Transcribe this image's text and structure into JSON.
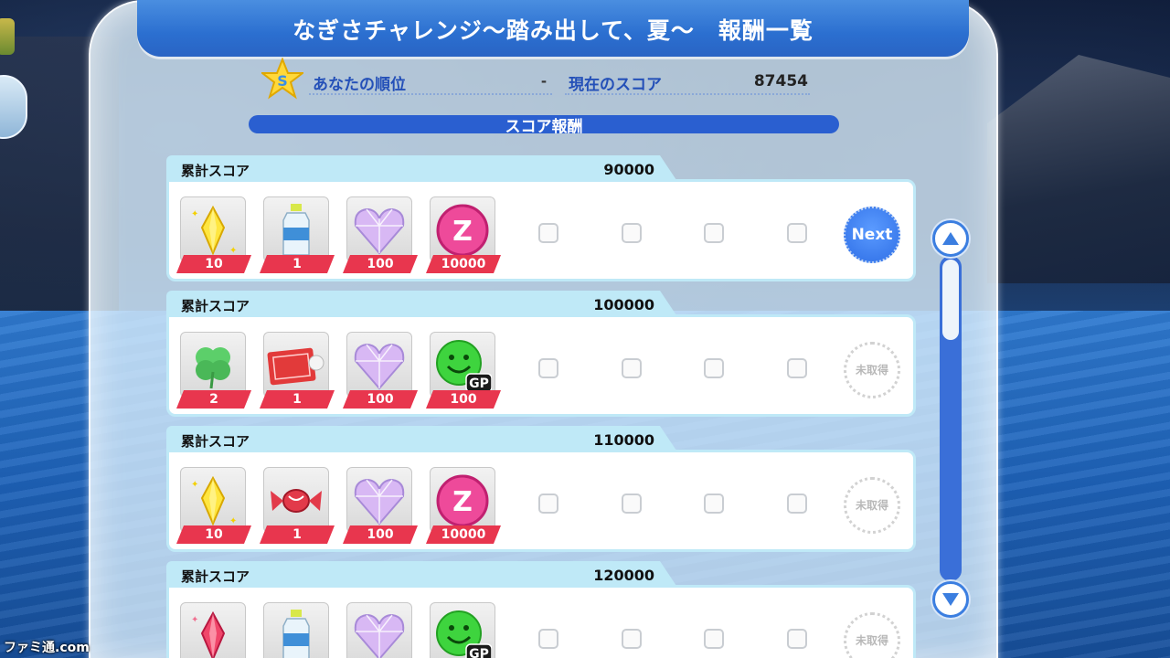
{
  "title": "なぎさチャレンジ〜踏み出して、夏〜　報酬一覧",
  "header": {
    "rank_label": "あなたの順位",
    "rank_value": "-",
    "score_label": "現在のスコア",
    "score_value": "87454"
  },
  "section_title": "スコア報酬",
  "rows": [
    {
      "label": "累計スコア",
      "score": "90000",
      "status": "Next",
      "items": [
        {
          "icon": "yellow-gem-icon",
          "count": "10"
        },
        {
          "icon": "water-bottle-icon",
          "count": "1"
        },
        {
          "icon": "crystal-heart-icon",
          "count": "100"
        },
        {
          "icon": "pink-zack-coin-icon",
          "count": "10000"
        }
      ]
    },
    {
      "label": "累計スコア",
      "score": "100000",
      "status": "未取得",
      "items": [
        {
          "icon": "green-clover-icon",
          "count": "2"
        },
        {
          "icon": "ticket-icon",
          "count": "1"
        },
        {
          "icon": "crystal-heart-icon",
          "count": "100"
        },
        {
          "icon": "green-smiley-gp-icon",
          "count": "100",
          "badge": "GP"
        }
      ]
    },
    {
      "label": "累計スコア",
      "score": "110000",
      "status": "未取得",
      "items": [
        {
          "icon": "yellow-gem-icon",
          "count": "10"
        },
        {
          "icon": "candy-icon",
          "count": "1"
        },
        {
          "icon": "crystal-heart-icon",
          "count": "100"
        },
        {
          "icon": "pink-zack-coin-icon",
          "count": "10000"
        }
      ]
    },
    {
      "label": "累計スコア",
      "score": "120000",
      "status": "未取得",
      "items": [
        {
          "icon": "red-gem-icon",
          "count": ""
        },
        {
          "icon": "water-bottle-icon",
          "count": ""
        },
        {
          "icon": "crystal-heart-icon",
          "count": ""
        },
        {
          "icon": "green-smiley-gp-icon",
          "count": "",
          "badge": "GP"
        }
      ]
    }
  ],
  "watermark": "ファミ通.com",
  "colors": {
    "title_bar": "#2b6fd0",
    "count_ribbon": "#e8364e",
    "next_button": "#2f6fe6",
    "scroll_track": "#3a6fd8"
  }
}
